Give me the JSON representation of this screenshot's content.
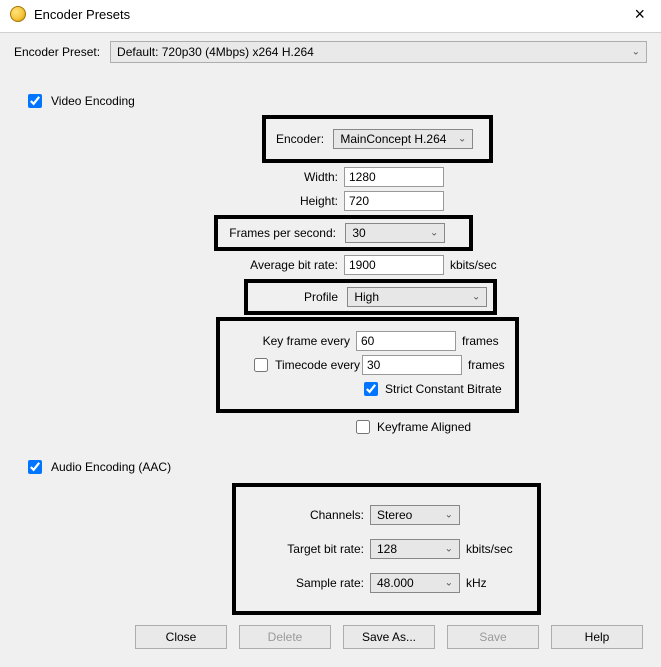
{
  "window": {
    "title": "Encoder Presets"
  },
  "preset": {
    "label": "Encoder Preset:",
    "value": "Default: 720p30 (4Mbps) x264 H.264"
  },
  "video": {
    "section_label": "Video Encoding",
    "checked": true,
    "encoder_label": "Encoder:",
    "encoder_value": "MainConcept H.264",
    "width_label": "Width:",
    "width_value": "1280",
    "height_label": "Height:",
    "height_value": "720",
    "fps_label": "Frames per second:",
    "fps_value": "30",
    "avgbr_label": "Average bit rate:",
    "avgbr_value": "1900",
    "avgbr_unit": "kbits/sec",
    "profile_label": "Profile",
    "profile_value": "High",
    "keyframe_label": "Key frame every",
    "keyframe_value": "60",
    "keyframe_unit": "frames",
    "timecode_label": "Timecode every",
    "timecode_checked": false,
    "timecode_value": "30",
    "timecode_unit": "frames",
    "strict_label": "Strict Constant Bitrate",
    "strict_checked": true,
    "kfalign_label": "Keyframe Aligned",
    "kfalign_checked": false
  },
  "audio": {
    "section_label": "Audio Encoding (AAC)",
    "checked": true,
    "channels_label": "Channels:",
    "channels_value": "Stereo",
    "targetbr_label": "Target bit rate:",
    "targetbr_value": "128",
    "targetbr_unit": "kbits/sec",
    "samplerate_label": "Sample rate:",
    "samplerate_value": "48.000",
    "samplerate_unit": "kHz"
  },
  "buttons": {
    "close": "Close",
    "delete": "Delete",
    "saveas": "Save As...",
    "save": "Save",
    "help": "Help"
  }
}
